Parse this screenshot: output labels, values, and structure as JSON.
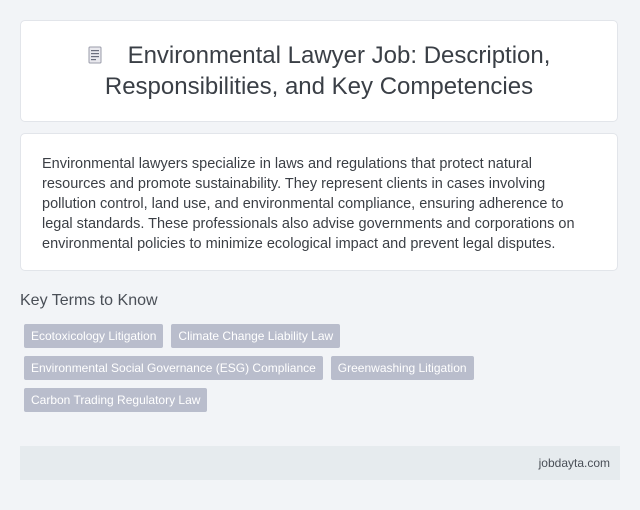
{
  "header": {
    "icon": "document-icon",
    "title": "Environmental Lawyer Job: Description, Responsibilities, and Key Competencies"
  },
  "description": "Environmental lawyers specialize in laws and regulations that protect natural resources and promote sustainability. They represent clients in cases involving pollution control, land use, and environmental compliance, ensuring adherence to legal standards. These professionals also advise governments and corporations on environmental policies to minimize ecological impact and prevent legal disputes.",
  "key_terms": {
    "heading": "Key Terms to Know",
    "tags": [
      "Ecotoxicology Litigation",
      "Climate Change Liability Law",
      "Environmental Social Governance (ESG) Compliance",
      "Greenwashing Litigation",
      "Carbon Trading Regulatory Law"
    ]
  },
  "footer": {
    "site": "jobdayta.com"
  },
  "colors": {
    "background": "#f2f4f7",
    "tag_background": "#b9bdcc",
    "footer_background": "#e6ebee"
  }
}
